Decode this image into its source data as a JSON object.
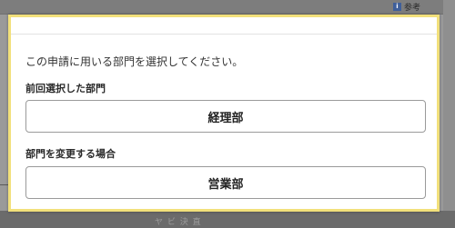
{
  "background": {
    "info_label": "参考",
    "bottom_text": "ヤ ビ 決 直"
  },
  "dialog": {
    "prompt": "この申請に用いる部門を選択してください。",
    "previous_section_label": "前回選択した部門",
    "previous_department": "経理部",
    "change_section_label": "部門を変更する場合",
    "change_department": "営業部"
  },
  "colors": {
    "modal_border": "#f2e07b",
    "overlay": "#8a8a8a"
  }
}
